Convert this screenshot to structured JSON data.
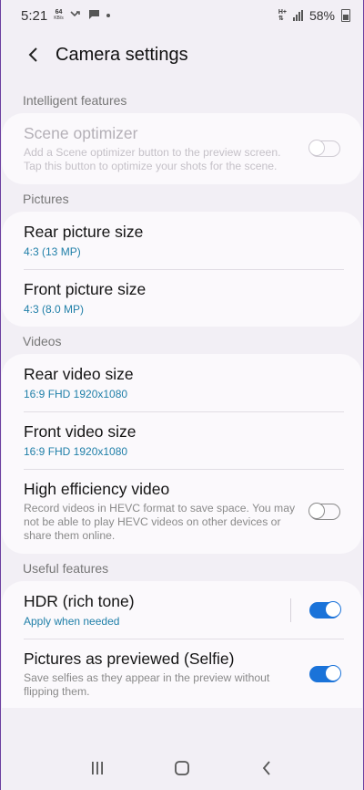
{
  "status_bar": {
    "time": "5:21",
    "netspeed_value": "64",
    "netspeed_unit": "KB/s",
    "network_type": "H+",
    "battery": "58%"
  },
  "header": {
    "title": "Camera settings"
  },
  "sections": {
    "intelligent": {
      "label": "Intelligent features",
      "scene_optimizer": {
        "title": "Scene optimizer",
        "desc": "Add a Scene optimizer button to the preview screen. Tap this button to optimize your shots for the scene.",
        "state": false
      }
    },
    "pictures": {
      "label": "Pictures",
      "rear": {
        "title": "Rear picture size",
        "value": "4:3 (13 MP)"
      },
      "front": {
        "title": "Front picture size",
        "value": "4:3 (8.0 MP)"
      }
    },
    "videos": {
      "label": "Videos",
      "rear": {
        "title": "Rear video size",
        "value": "16:9 FHD 1920x1080"
      },
      "front": {
        "title": "Front video size",
        "value": "16:9 FHD 1920x1080"
      },
      "hevc": {
        "title": "High efficiency video",
        "desc": "Record videos in HEVC format to save space. You may not be able to play HEVC videos on other devices or share them online.",
        "state": false
      }
    },
    "useful": {
      "label": "Useful features",
      "hdr": {
        "title": "HDR (rich tone)",
        "value": "Apply when needed",
        "state": true
      },
      "pictures_as_previewed": {
        "title": "Pictures as previewed (Selfie)",
        "desc": "Save selfies as they appear in the preview without flipping them.",
        "state": true
      }
    }
  },
  "colors": {
    "accent": "#1a73d9",
    "value_text": "#1f7fa8",
    "background": "#f2eff5"
  }
}
